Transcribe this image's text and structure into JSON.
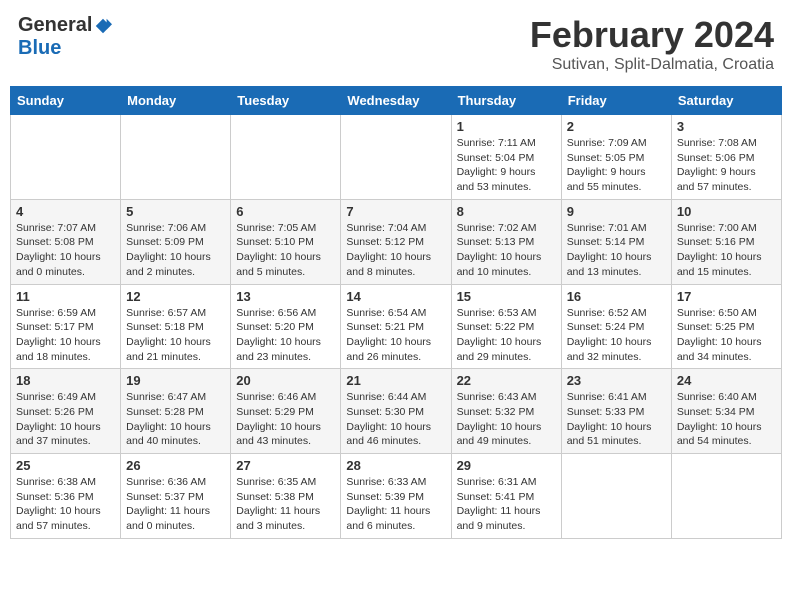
{
  "header": {
    "logo_general": "General",
    "logo_blue": "Blue",
    "month_year": "February 2024",
    "subtitle": "Sutivan, Split-Dalmatia, Croatia"
  },
  "days_of_week": [
    "Sunday",
    "Monday",
    "Tuesday",
    "Wednesday",
    "Thursday",
    "Friday",
    "Saturday"
  ],
  "weeks": [
    [
      {
        "day": "",
        "info": ""
      },
      {
        "day": "",
        "info": ""
      },
      {
        "day": "",
        "info": ""
      },
      {
        "day": "",
        "info": ""
      },
      {
        "day": "1",
        "info": "Sunrise: 7:11 AM\nSunset: 5:04 PM\nDaylight: 9 hours\nand 53 minutes."
      },
      {
        "day": "2",
        "info": "Sunrise: 7:09 AM\nSunset: 5:05 PM\nDaylight: 9 hours\nand 55 minutes."
      },
      {
        "day": "3",
        "info": "Sunrise: 7:08 AM\nSunset: 5:06 PM\nDaylight: 9 hours\nand 57 minutes."
      }
    ],
    [
      {
        "day": "4",
        "info": "Sunrise: 7:07 AM\nSunset: 5:08 PM\nDaylight: 10 hours\nand 0 minutes."
      },
      {
        "day": "5",
        "info": "Sunrise: 7:06 AM\nSunset: 5:09 PM\nDaylight: 10 hours\nand 2 minutes."
      },
      {
        "day": "6",
        "info": "Sunrise: 7:05 AM\nSunset: 5:10 PM\nDaylight: 10 hours\nand 5 minutes."
      },
      {
        "day": "7",
        "info": "Sunrise: 7:04 AM\nSunset: 5:12 PM\nDaylight: 10 hours\nand 8 minutes."
      },
      {
        "day": "8",
        "info": "Sunrise: 7:02 AM\nSunset: 5:13 PM\nDaylight: 10 hours\nand 10 minutes."
      },
      {
        "day": "9",
        "info": "Sunrise: 7:01 AM\nSunset: 5:14 PM\nDaylight: 10 hours\nand 13 minutes."
      },
      {
        "day": "10",
        "info": "Sunrise: 7:00 AM\nSunset: 5:16 PM\nDaylight: 10 hours\nand 15 minutes."
      }
    ],
    [
      {
        "day": "11",
        "info": "Sunrise: 6:59 AM\nSunset: 5:17 PM\nDaylight: 10 hours\nand 18 minutes."
      },
      {
        "day": "12",
        "info": "Sunrise: 6:57 AM\nSunset: 5:18 PM\nDaylight: 10 hours\nand 21 minutes."
      },
      {
        "day": "13",
        "info": "Sunrise: 6:56 AM\nSunset: 5:20 PM\nDaylight: 10 hours\nand 23 minutes."
      },
      {
        "day": "14",
        "info": "Sunrise: 6:54 AM\nSunset: 5:21 PM\nDaylight: 10 hours\nand 26 minutes."
      },
      {
        "day": "15",
        "info": "Sunrise: 6:53 AM\nSunset: 5:22 PM\nDaylight: 10 hours\nand 29 minutes."
      },
      {
        "day": "16",
        "info": "Sunrise: 6:52 AM\nSunset: 5:24 PM\nDaylight: 10 hours\nand 32 minutes."
      },
      {
        "day": "17",
        "info": "Sunrise: 6:50 AM\nSunset: 5:25 PM\nDaylight: 10 hours\nand 34 minutes."
      }
    ],
    [
      {
        "day": "18",
        "info": "Sunrise: 6:49 AM\nSunset: 5:26 PM\nDaylight: 10 hours\nand 37 minutes."
      },
      {
        "day": "19",
        "info": "Sunrise: 6:47 AM\nSunset: 5:28 PM\nDaylight: 10 hours\nand 40 minutes."
      },
      {
        "day": "20",
        "info": "Sunrise: 6:46 AM\nSunset: 5:29 PM\nDaylight: 10 hours\nand 43 minutes."
      },
      {
        "day": "21",
        "info": "Sunrise: 6:44 AM\nSunset: 5:30 PM\nDaylight: 10 hours\nand 46 minutes."
      },
      {
        "day": "22",
        "info": "Sunrise: 6:43 AM\nSunset: 5:32 PM\nDaylight: 10 hours\nand 49 minutes."
      },
      {
        "day": "23",
        "info": "Sunrise: 6:41 AM\nSunset: 5:33 PM\nDaylight: 10 hours\nand 51 minutes."
      },
      {
        "day": "24",
        "info": "Sunrise: 6:40 AM\nSunset: 5:34 PM\nDaylight: 10 hours\nand 54 minutes."
      }
    ],
    [
      {
        "day": "25",
        "info": "Sunrise: 6:38 AM\nSunset: 5:36 PM\nDaylight: 10 hours\nand 57 minutes."
      },
      {
        "day": "26",
        "info": "Sunrise: 6:36 AM\nSunset: 5:37 PM\nDaylight: 11 hours\nand 0 minutes."
      },
      {
        "day": "27",
        "info": "Sunrise: 6:35 AM\nSunset: 5:38 PM\nDaylight: 11 hours\nand 3 minutes."
      },
      {
        "day": "28",
        "info": "Sunrise: 6:33 AM\nSunset: 5:39 PM\nDaylight: 11 hours\nand 6 minutes."
      },
      {
        "day": "29",
        "info": "Sunrise: 6:31 AM\nSunset: 5:41 PM\nDaylight: 11 hours\nand 9 minutes."
      },
      {
        "day": "",
        "info": ""
      },
      {
        "day": "",
        "info": ""
      }
    ]
  ]
}
